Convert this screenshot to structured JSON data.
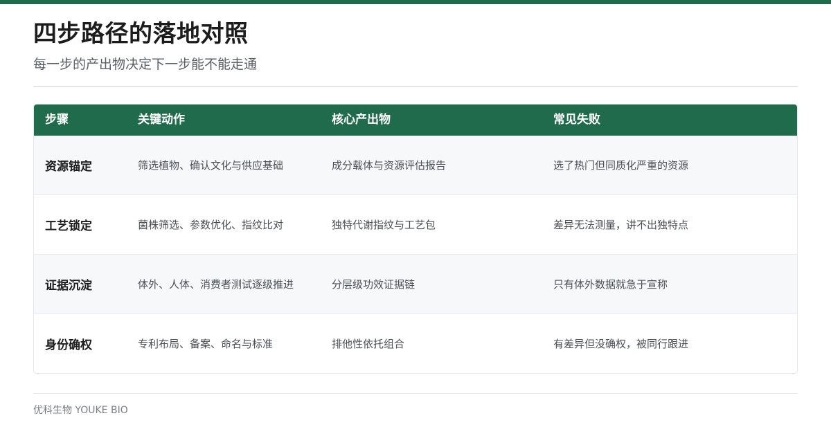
{
  "colors": {
    "accent": "#1f6b4c",
    "row_alt": "#f6f8fa",
    "divider": "#e3e6ea"
  },
  "header": {
    "title": "四步路径的落地对照",
    "subtitle": "每一步的产出物决定下一步能不能走通"
  },
  "table": {
    "columns": [
      "步骤",
      "关键动作",
      "核心产出物",
      "常见失败"
    ],
    "rows": [
      [
        "资源锚定",
        "筛选植物、确认文化与供应基础",
        "成分载体与资源评估报告",
        "选了热门但同质化严重的资源"
      ],
      [
        "工艺锁定",
        "菌株筛选、参数优化、指纹比对",
        "独特代谢指纹与工艺包",
        "差异无法测量，讲不出独特点"
      ],
      [
        "证据沉淀",
        "体外、人体、消费者测试逐级推进",
        "分层级功效证据链",
        "只有体外数据就急于宣称"
      ],
      [
        "身份确权",
        "专利布局、备案、命名与标准",
        "排他性依托组合",
        "有差异但没确权，被同行跟进"
      ]
    ]
  },
  "footer": {
    "text": "优科生物 YOUKE BIO"
  }
}
